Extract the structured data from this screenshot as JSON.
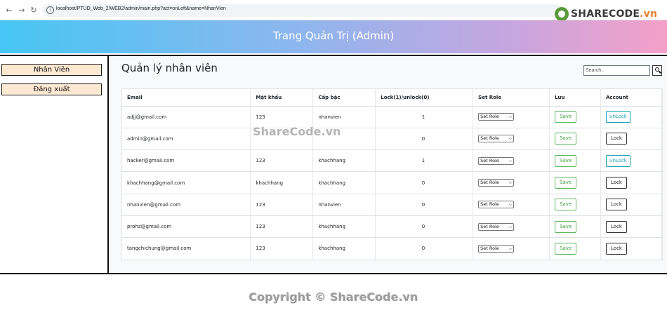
{
  "browser": {
    "url": "localhost/PTUD_Web_2/WEB2/admin/main.php?act=onLeft&name=NhanVien",
    "logo_text_main": "SHARECODE",
    "logo_text_suffix": ".vn"
  },
  "header": {
    "title": "Trang Quản Trị (Admin)"
  },
  "sidebar": {
    "items": [
      {
        "label": "Nhân Viên"
      },
      {
        "label": "Đăng xuất"
      }
    ]
  },
  "main": {
    "title": "Quản lý nhân viên",
    "search": {
      "placeholder": "Search.."
    }
  },
  "table": {
    "headers": {
      "email": "Email",
      "password": "Mật khẩu",
      "level": "Cấp bậc",
      "lock": "Lock(1)/unlock(0)",
      "set_role": "Set Role",
      "save": "Lưu",
      "account": "Account"
    },
    "rows": [
      {
        "email": "adjj@gmail.com",
        "password": "123",
        "level": "nhanvien",
        "lock": "1",
        "role_select": "Set Role",
        "save_label": "Save",
        "account_label": "unLock"
      },
      {
        "email": "admin@gmail.com",
        "password": "",
        "level": "",
        "lock": "0",
        "role_select": "Set Role",
        "save_label": "Save",
        "account_label": "Lock"
      },
      {
        "email": "hacker@gmail.com",
        "password": "123",
        "level": "khachhang",
        "lock": "1",
        "role_select": "Set Role",
        "save_label": "Save",
        "account_label": "unLock"
      },
      {
        "email": "khachhang@gmail.com",
        "password": "khachhang",
        "level": "khachhang",
        "lock": "0",
        "role_select": "Set Role",
        "save_label": "Save",
        "account_label": "Lock"
      },
      {
        "email": "nhanvien@gmail.com",
        "password": "123",
        "level": "nhanvien",
        "lock": "0",
        "role_select": "Set Role",
        "save_label": "Save",
        "account_label": "Lock"
      },
      {
        "email": "prohz@gmail.com",
        "password": "123",
        "level": "khachhang",
        "lock": "0",
        "role_select": "Set Role",
        "save_label": "Save",
        "account_label": "Lock"
      },
      {
        "email": "tangchichung@gmail.com",
        "password": "123",
        "level": "khachhang",
        "lock": "0",
        "role_select": "Set Role",
        "save_label": "Save",
        "account_label": "Lock"
      }
    ]
  },
  "watermark": {
    "text": "ShareCode.vn"
  },
  "footer": {
    "copyright": "Copyright © ShareCode.vn"
  },
  "colors": {
    "header_start": "#46c6f4",
    "header_end": "#f4a0c8",
    "sidebar_button_bg": "#fde9d2",
    "save_green": "#5cb85c",
    "unlock_teal": "#17a2b8"
  }
}
